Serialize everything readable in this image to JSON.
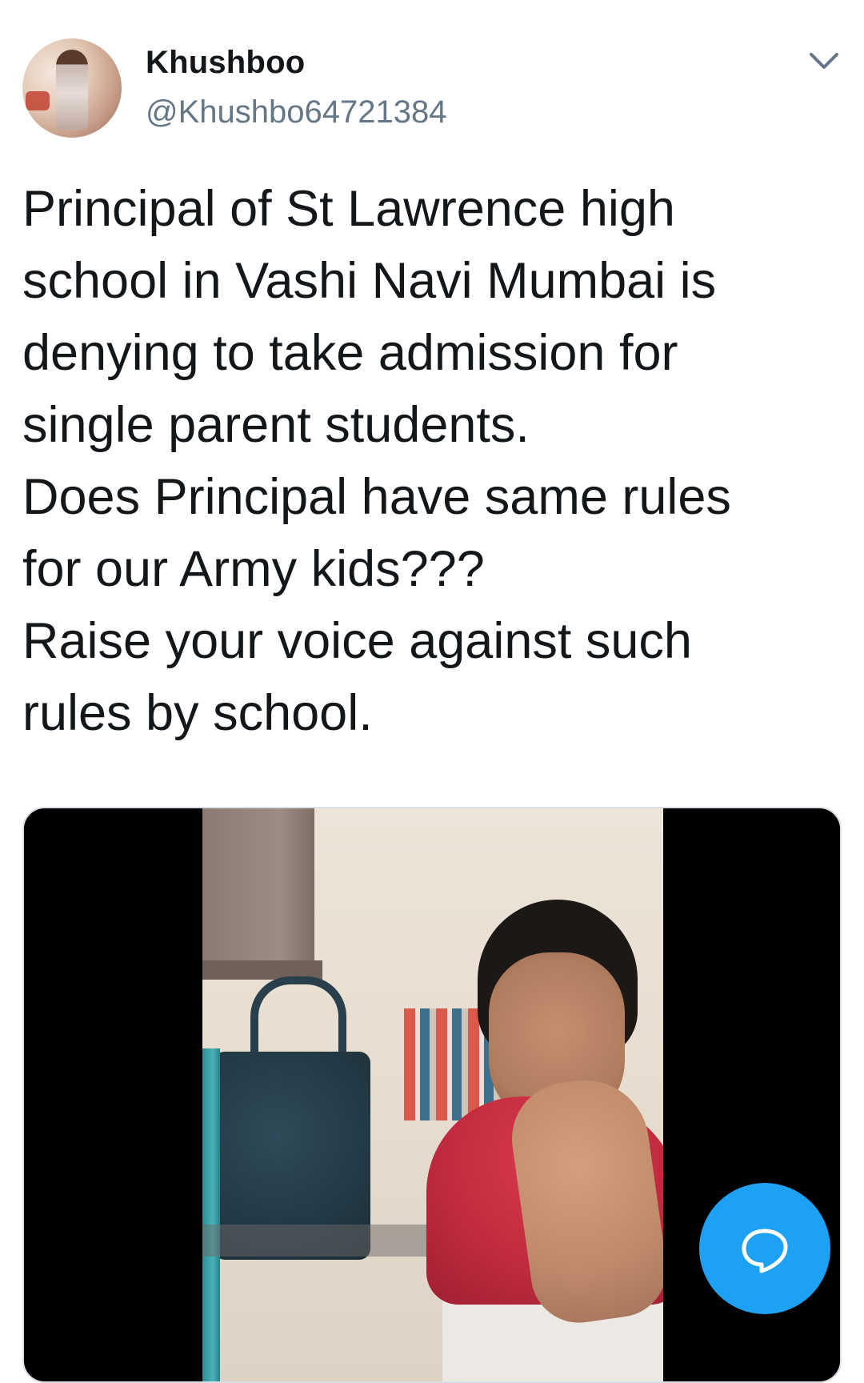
{
  "user": {
    "display_name": "Khushboo",
    "handle": "@Khushbo64721384",
    "avatar_icon": "profile-photo"
  },
  "header": {
    "menu_icon": "chevron-down-icon"
  },
  "tweet": {
    "lines": [
      "Principal of St Lawrence high",
      "school in Vashi Navi Mumbai is",
      "denying to take admission for",
      "single parent students.",
      "Does Principal have same rules",
      "for our Army kids???",
      "Raise your voice against such",
      "rules by school."
    ]
  },
  "media": {
    "type": "video"
  },
  "fab": {
    "icon": "speech-bubble-icon",
    "color": "#1da1f2"
  },
  "colors": {
    "text_primary": "#14171a",
    "text_secondary": "#657786",
    "accent": "#1da1f2"
  }
}
